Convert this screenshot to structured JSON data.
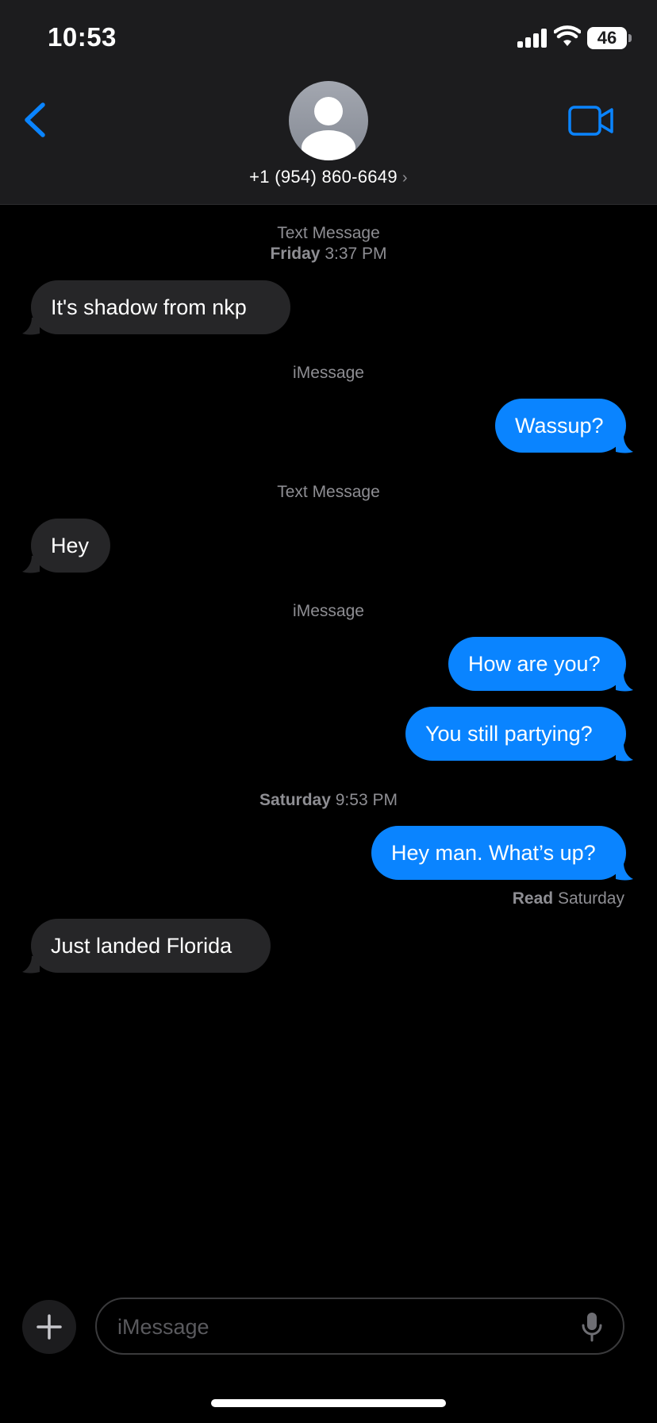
{
  "status_bar": {
    "time": "10:53",
    "battery": "46",
    "icons": [
      "signal-icon",
      "wifi-icon",
      "battery-icon"
    ]
  },
  "header": {
    "contact": "+1 (954) 860-6649",
    "chevron": "›",
    "back_icon": "chevron-left-icon",
    "video_icon": "video-camera-icon",
    "avatar_icon": "person-silhouette-icon"
  },
  "thread": {
    "label_text_message_1": "Text Message",
    "stamp_1_day": "Friday",
    "stamp_1_time": "3:37 PM",
    "msg_1": "It's shadow from nkp",
    "label_imessage_1": "iMessage",
    "msg_2": "Wassup?",
    "label_text_message_2": "Text Message",
    "msg_3": "Hey",
    "label_imessage_2": "iMessage",
    "msg_4": "How are you?",
    "msg_5": "You still partying?",
    "stamp_2_day": "Saturday",
    "stamp_2_time": "9:53 PM",
    "msg_6": "Hey man. What’s up?",
    "read_label": "Read",
    "read_day": "Saturday",
    "msg_7": "Just landed Florida"
  },
  "composer": {
    "placeholder": "iMessage",
    "value": "",
    "plus_icon": "plus-icon",
    "mic_icon": "microphone-icon"
  },
  "colors": {
    "accent": "#0a84ff",
    "incoming_bubble": "#262628",
    "header_bg": "#1c1c1e",
    "secondary_text": "#8e8e93"
  }
}
